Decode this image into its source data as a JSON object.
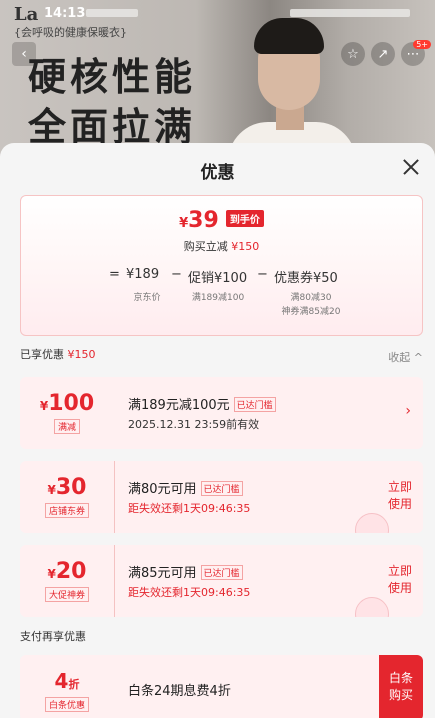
{
  "status_bar": {
    "time": "14:13"
  },
  "background": {
    "brand": "La",
    "slogan": "{会呼吸的健康保暖衣}",
    "headline_line1": "硬核性能",
    "headline_line2": "全面拉满",
    "notification_badge": "5+"
  },
  "sheet": {
    "title": "优惠",
    "summary": {
      "currency": "¥",
      "final_price": "39",
      "final_tag": "到手价",
      "instant_discount_label": "购买立减",
      "instant_discount_value": "¥150",
      "breakdown": {
        "equals": "=",
        "base_price": "¥189",
        "base_label": "京东价",
        "minus1": "−",
        "promo": "促销¥100",
        "promo_label": "满189减100",
        "minus2": "−",
        "coupon": "优惠券¥50",
        "coupon_label1": "满80减30",
        "coupon_label2": "神券满85减20"
      }
    },
    "enjoyed": {
      "label": "已享优惠",
      "value": "¥150",
      "collapse": "收起 ^"
    },
    "coupons": [
      {
        "currency": "¥",
        "amount": "100",
        "kind": "满减",
        "title": "满189元减100元",
        "badge": "已达门槛",
        "detail": "2025.12.31 23:59前有效",
        "action": "›"
      },
      {
        "currency": "¥",
        "amount": "30",
        "kind": "店铺东券",
        "title": "满80元可用",
        "badge": "已达门槛",
        "detail": "距失效还剩1天09:46:35",
        "action_line1": "立即",
        "action_line2": "使用"
      },
      {
        "currency": "¥",
        "amount": "20",
        "kind": "大促神券",
        "title": "满85元可用",
        "badge": "已达门槛",
        "detail": "距失效还剩1天09:46:35",
        "action_line1": "立即",
        "action_line2": "使用"
      }
    ],
    "pay_section": {
      "label": "支付再享优惠",
      "value": "4",
      "unit": "折",
      "kind": "白条优惠",
      "description": "白条24期息费4折",
      "action_line1": "白条",
      "action_line2": "购买"
    }
  },
  "colors": {
    "accent": "#e4262e",
    "coupon_bg": "#fff0f1",
    "sheet_bg": "#f5f5f5"
  }
}
